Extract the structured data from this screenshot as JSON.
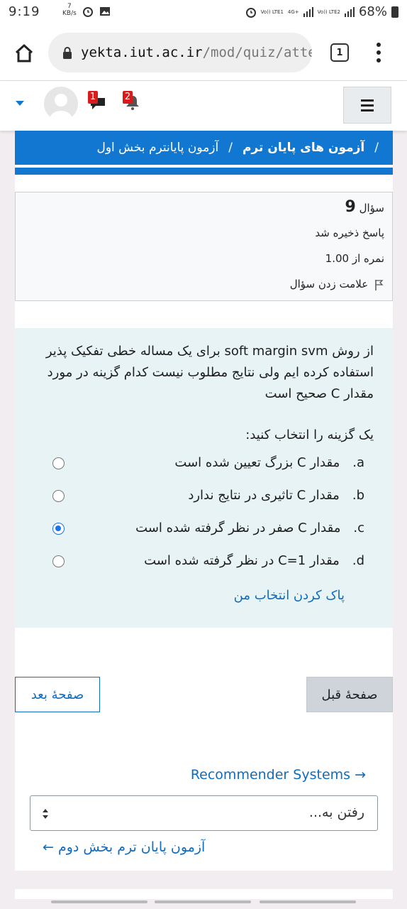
{
  "status_bar": {
    "time": "9:19",
    "speed_value": "7",
    "speed_unit": "KB/s",
    "network_1": "Vo)) LTE1",
    "network_1_type": "4G+",
    "network_2": "Vo)) LTE2",
    "battery": "68%"
  },
  "browser": {
    "url_host": "yekta.iut.ac.ir",
    "url_path": "/mod/quiz/atte",
    "tab_count": "1"
  },
  "header": {
    "messages_badge": "1",
    "notifications_badge": "2"
  },
  "breadcrumb": {
    "sep1": "/",
    "item1": "آزمون های پایان ترم",
    "sep2": "/",
    "item2": "آزمون پایانترم بخش اول"
  },
  "question_info": {
    "label": "سؤال",
    "number": "9",
    "status": "پاسخ ذخیره شد",
    "grade": "نمره از 1.00",
    "flag_label": "علامت زدن سؤال"
  },
  "question": {
    "text": "از روش soft margin svm برای یک مساله خطی تفکیک پذیر استفاده کرده ایم ولی نتایج مطلوب نیست کدام گزینه در مورد مقدار C صحیح است",
    "prompt": "یک گزینه را انتخاب کنید:",
    "answers": [
      {
        "letter": "a.",
        "text": "مقدار C بزرگ تعیین شده است",
        "checked": false
      },
      {
        "letter": "b.",
        "text": "مقدار C تاثیری در نتایج ندارد",
        "checked": false
      },
      {
        "letter": "c.",
        "text": "مقدار C صفر در نظر گرفته شده است",
        "checked": true
      },
      {
        "letter": "d.",
        "text": "مقدار C=1 در نظر گرفته شده است",
        "checked": false
      }
    ],
    "clear_choice": "پاک کردن انتخاب من"
  },
  "navigation": {
    "prev_button": "صفحهٔ قبل",
    "next_button": "صفحهٔ بعد",
    "next_activity": "Recommender Systems →",
    "jump_placeholder": "رفتن به...",
    "prev_activity": "آزمون پایان ترم بخش دوم ←"
  },
  "colors": {
    "brand_blue": "#1177d1",
    "link_blue": "#0f6cbf",
    "question_bg": "#e7f3f5",
    "badge_red": "#d91b1b"
  }
}
